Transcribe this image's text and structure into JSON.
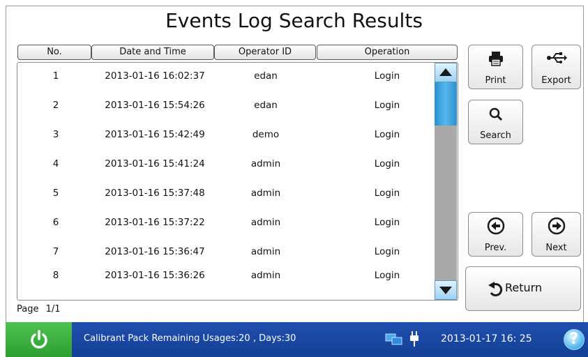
{
  "title": "Events Log Search Results",
  "table": {
    "columns": [
      "No.",
      "Date and Time",
      "Operator ID",
      "Operation"
    ],
    "rows": [
      {
        "no": "1",
        "datetime": "2013-01-16 16:02:37",
        "operator": "edan",
        "operation": "Login"
      },
      {
        "no": "2",
        "datetime": "2013-01-16 15:54:26",
        "operator": "edan",
        "operation": "Login"
      },
      {
        "no": "3",
        "datetime": "2013-01-16 15:42:49",
        "operator": "demo",
        "operation": "Login"
      },
      {
        "no": "4",
        "datetime": "2013-01-16 15:41:24",
        "operator": "admin",
        "operation": "Login"
      },
      {
        "no": "5",
        "datetime": "2013-01-16 15:37:48",
        "operator": "admin",
        "operation": "Login"
      },
      {
        "no": "6",
        "datetime": "2013-01-16 15:37:22",
        "operator": "admin",
        "operation": "Login"
      },
      {
        "no": "7",
        "datetime": "2013-01-16 15:36:47",
        "operator": "admin",
        "operation": "Login"
      },
      {
        "no": "8",
        "datetime": "2013-01-16 15:36:26",
        "operator": "admin",
        "operation": "Login"
      }
    ]
  },
  "page": {
    "label": "Page",
    "value": "1/1"
  },
  "buttons": {
    "print": "Print",
    "export": "Export",
    "search": "Search",
    "prev": "Prev.",
    "next": "Next",
    "return": "Return"
  },
  "status_bar": {
    "message": "Calibrant Pack Remaining Usages:20 , Days:30",
    "datetime": "2013-01-17  16: 25",
    "help": "?"
  },
  "icons": {
    "print": "printer-icon",
    "export": "usb-icon",
    "search": "magnifier-icon",
    "prev": "arrow-left-icon",
    "next": "arrow-right-icon",
    "return": "return-arrow-icon",
    "power": "power-icon",
    "network": "network-icon",
    "plug": "power-plug-icon",
    "scroll_up": "scroll-up-icon",
    "scroll_down": "scroll-down-icon"
  },
  "colors": {
    "status_bar": "#1f4fae",
    "power_button": "#3fb143",
    "scroll_thumb": "#2a8fd0",
    "scroll_track": "#a9a9a9"
  }
}
